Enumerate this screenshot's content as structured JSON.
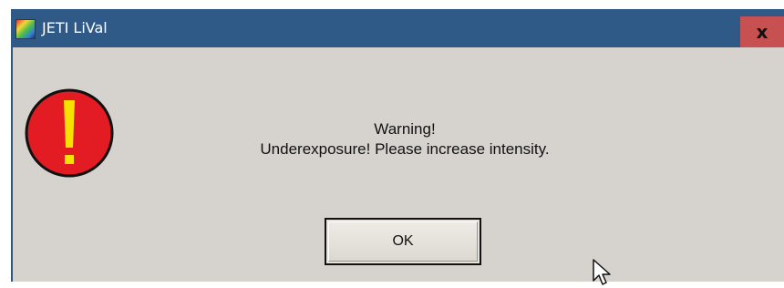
{
  "window": {
    "title": "JETI LiVal",
    "close_label": "x"
  },
  "dialog": {
    "icon": "warning-exclamation-icon",
    "message_line1": "Warning!",
    "message_line2": "Underexposure! Please increase intensity.",
    "ok_label": "OK"
  },
  "colors": {
    "titlebar": "#2f5a88",
    "close_button": "#c75050",
    "dialog_background": "#d6d3ce",
    "warning_icon_fill": "#e31b23",
    "warning_icon_mark": "#f6e200"
  }
}
